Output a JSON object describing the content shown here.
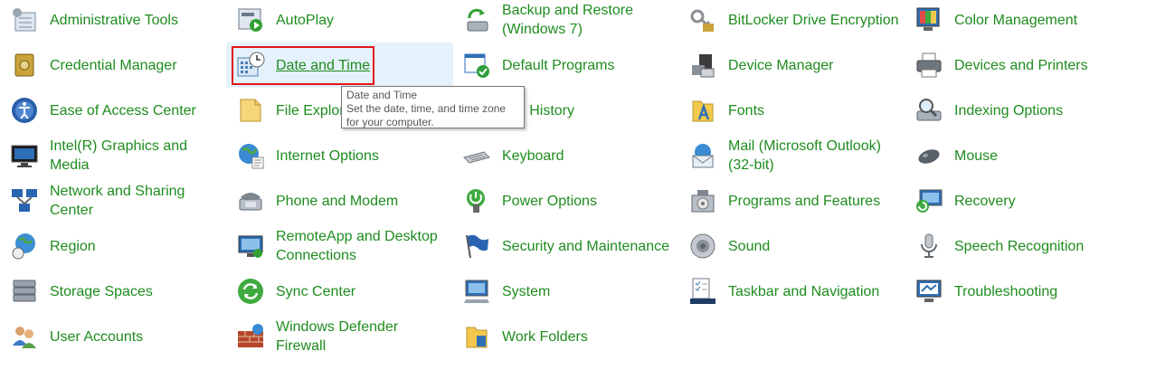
{
  "accent_color": "#1e8c1e",
  "highlight_border_color": "#e3151a",
  "columns": [
    {
      "items": [
        {
          "label": "Administrative Tools",
          "icon": "admin-tools-icon"
        },
        {
          "label": "Credential Manager",
          "icon": "credential-vault-icon"
        },
        {
          "label": "Ease of Access Center",
          "icon": "ease-of-access-icon"
        },
        {
          "label": "Intel(R) Graphics and Media",
          "icon": "intel-graphics-icon"
        },
        {
          "label": "Network and Sharing Center",
          "icon": "network-icon"
        },
        {
          "label": "Region",
          "icon": "globe-clock-icon"
        },
        {
          "label": "Storage Spaces",
          "icon": "storage-drives-icon"
        },
        {
          "label": "User Accounts",
          "icon": "users-icon"
        }
      ]
    },
    {
      "items": [
        {
          "label": "AutoPlay",
          "icon": "autoplay-icon"
        },
        {
          "label": "Date and Time",
          "icon": "calendar-clock-icon"
        },
        {
          "label": "File Explorer Options",
          "icon": "folder-options-icon"
        },
        {
          "label": "Internet Options",
          "icon": "internet-globe-icon"
        },
        {
          "label": "Phone and Modem",
          "icon": "phone-icon"
        },
        {
          "label": "RemoteApp and Desktop Connections",
          "icon": "remote-desktop-icon"
        },
        {
          "label": "Sync Center",
          "icon": "sync-icon"
        },
        {
          "label": "Windows Defender Firewall",
          "icon": "firewall-icon"
        }
      ]
    },
    {
      "items": [
        {
          "label": "Backup and Restore (Windows 7)",
          "icon": "backup-icon"
        },
        {
          "label": "Default Programs",
          "icon": "default-programs-icon"
        },
        {
          "label": "File History",
          "icon": "file-history-icon"
        },
        {
          "label": "Keyboard",
          "icon": "keyboard-icon"
        },
        {
          "label": "Power Options",
          "icon": "power-icon"
        },
        {
          "label": "Security and Maintenance",
          "icon": "flag-icon"
        },
        {
          "label": "System",
          "icon": "system-monitor-icon"
        },
        {
          "label": "Work Folders",
          "icon": "work-folders-icon"
        }
      ]
    },
    {
      "items": [
        {
          "label": "BitLocker Drive Encryption",
          "icon": "bitlocker-keys-icon"
        },
        {
          "label": "Device Manager",
          "icon": "device-manager-icon"
        },
        {
          "label": "Fonts",
          "icon": "fonts-icon"
        },
        {
          "label": "Mail (Microsoft Outlook) (32-bit)",
          "icon": "mail-icon"
        },
        {
          "label": "Programs and Features",
          "icon": "programs-icon"
        },
        {
          "label": "Sound",
          "icon": "speaker-icon"
        },
        {
          "label": "Taskbar and Navigation",
          "icon": "taskbar-icon"
        }
      ]
    },
    {
      "items": [
        {
          "label": "Color Management",
          "icon": "color-management-icon"
        },
        {
          "label": "Devices and Printers",
          "icon": "printer-icon"
        },
        {
          "label": "Indexing Options",
          "icon": "indexing-icon"
        },
        {
          "label": "Mouse",
          "icon": "mouse-icon"
        },
        {
          "label": "Recovery",
          "icon": "recovery-icon"
        },
        {
          "label": "Speech Recognition",
          "icon": "microphone-icon"
        },
        {
          "label": "Troubleshooting",
          "icon": "troubleshooting-icon"
        }
      ]
    }
  ],
  "tooltip": {
    "title": "Date and Time",
    "description": "Set the date, time, and time zone for your computer."
  }
}
